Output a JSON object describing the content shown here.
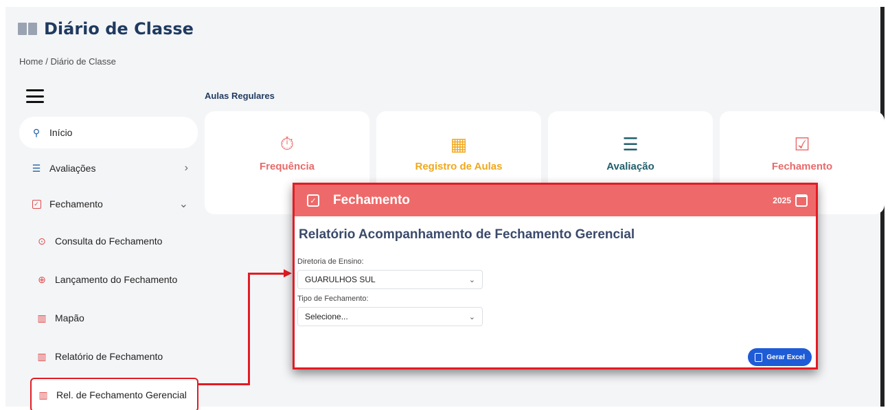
{
  "app": {
    "title": "Diário de Classe"
  },
  "breadcrumb": {
    "text": "Home  /  Diário de Classe"
  },
  "sidebar": {
    "items": [
      {
        "label": "Início",
        "icon": "location-pin-icon"
      },
      {
        "label": "Avaliações",
        "icon": "document-list-icon"
      },
      {
        "label": "Fechamento",
        "icon": "checkbox-icon"
      },
      {
        "label": "Consulta do Fechamento",
        "icon": "search-scan-icon"
      },
      {
        "label": "Lançamento do Fechamento",
        "icon": "file-add-icon"
      },
      {
        "label": "Mapão",
        "icon": "map-icon"
      },
      {
        "label": "Relatório de Fechamento",
        "icon": "map-icon"
      },
      {
        "label": "Rel. de Fechamento Gerencial",
        "icon": "map-icon"
      }
    ]
  },
  "main": {
    "section_label": "Aulas Regulares",
    "cards": [
      {
        "label": "Frequência",
        "color": "#e86a6a",
        "icon": "stopwatch-icon"
      },
      {
        "label": "Registro de Aulas",
        "color": "#f0a81c",
        "icon": "calendar-check-icon"
      },
      {
        "label": "Avaliação",
        "color": "#1f5f6b",
        "icon": "document-list-icon"
      },
      {
        "label": "Fechamento",
        "color": "#e86a6a",
        "icon": "checkbox-icon"
      }
    ]
  },
  "modal": {
    "header_title": "Fechamento",
    "year": "2025",
    "title": "Relatório Acompanhamento de Fechamento Gerencial",
    "diretoria_label": "Diretoria de Ensino:",
    "diretoria_value": "GUARULHOS SUL",
    "tipo_label": "Tipo de Fechamento:",
    "tipo_value": "Selecione...",
    "excel_button": "Gerar Excel"
  },
  "colors": {
    "accent_red": "#e31b23",
    "header_red": "#ee6a6a",
    "primary_blue": "#1e5bd6",
    "title_navy": "#1f3a5f"
  }
}
